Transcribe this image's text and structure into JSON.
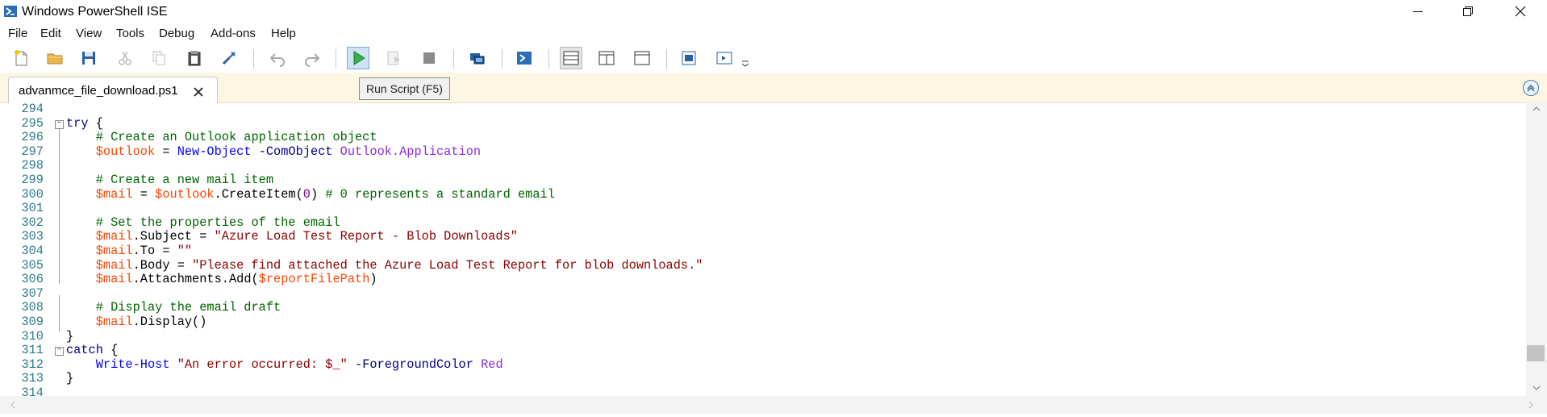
{
  "window": {
    "title": "Windows PowerShell ISE",
    "controls": [
      "minimize",
      "restore",
      "close"
    ]
  },
  "menu": [
    "File",
    "Edit",
    "View",
    "Tools",
    "Debug",
    "Add-ons",
    "Help"
  ],
  "toolbar": {
    "buttons": [
      "new-script",
      "open",
      "save",
      "cut",
      "copy",
      "paste",
      "clear-console",
      "undo",
      "redo",
      "run-script",
      "run-selection",
      "stop",
      "new-remote-tab",
      "start-powershell",
      "show-script-pane-top",
      "show-script-pane-right",
      "show-script-pane-maximized",
      "show-command-window",
      "show-command-add-on"
    ],
    "tooltip": "Run Script (F5)"
  },
  "tab": {
    "label": "advanmce_file_download.ps1"
  },
  "editor": {
    "lines": [
      {
        "n": "294",
        "text": ""
      },
      {
        "n": "295",
        "text": "try {"
      },
      {
        "n": "296",
        "text": "    # Create an Outlook application object"
      },
      {
        "n": "297",
        "text": "    $outlook = New-Object -ComObject Outlook.Application"
      },
      {
        "n": "298",
        "text": ""
      },
      {
        "n": "299",
        "text": "    # Create a new mail item"
      },
      {
        "n": "300",
        "text": "    $mail = $outlook.CreateItem(0) # 0 represents a standard email"
      },
      {
        "n": "301",
        "text": ""
      },
      {
        "n": "302",
        "text": "    # Set the properties of the email"
      },
      {
        "n": "303",
        "text": "    $mail.Subject = \"Azure Load Test Report - Blob Downloads\""
      },
      {
        "n": "304",
        "text": "    $mail.To = \"\""
      },
      {
        "n": "305",
        "text": "    $mail.Body = \"Please find attached the Azure Load Test Report for blob downloads.\""
      },
      {
        "n": "306",
        "text": "    $mail.Attachments.Add($reportFilePath)"
      },
      {
        "n": "307",
        "text": ""
      },
      {
        "n": "308",
        "text": "    # Display the email draft"
      },
      {
        "n": "309",
        "text": "    $mail.Display()"
      },
      {
        "n": "310",
        "text": "}"
      },
      {
        "n": "311",
        "text": "catch {"
      },
      {
        "n": "312",
        "text": "    Write-Host \"An error occurred: $_\" -ForegroundColor Red"
      },
      {
        "n": "313",
        "text": "}"
      },
      {
        "n": "314",
        "text": ""
      }
    ]
  }
}
